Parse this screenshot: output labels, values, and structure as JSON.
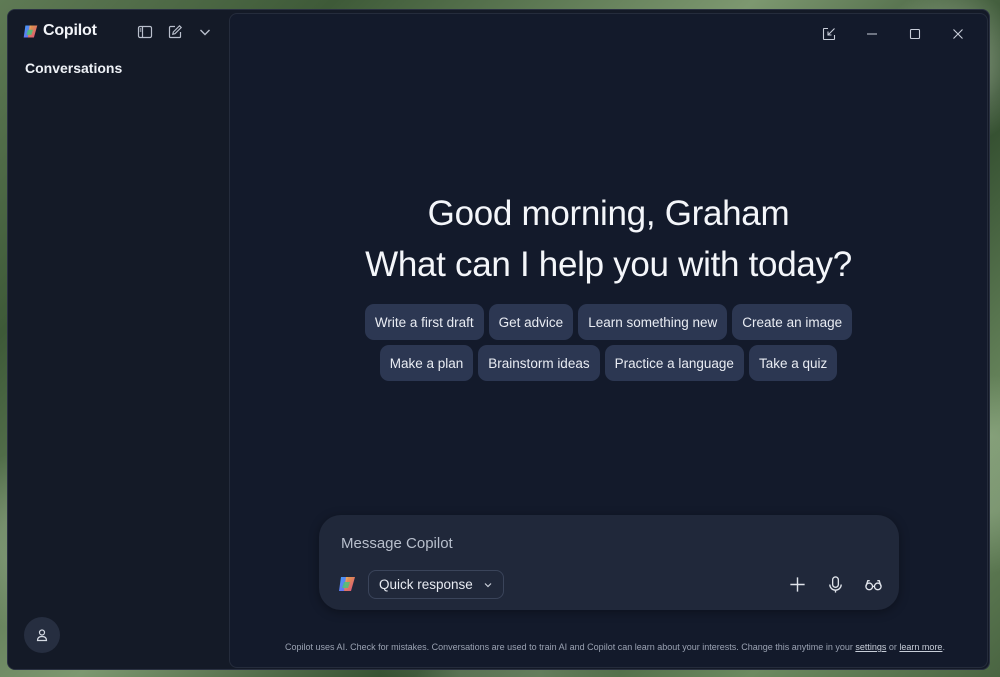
{
  "app": {
    "name": "Copilot"
  },
  "sidebar": {
    "heading": "Conversations"
  },
  "main": {
    "greeting_line1": "Good morning, Graham",
    "greeting_line2": "What can I help you with today?",
    "suggestions_row1": [
      "Write a first draft",
      "Get advice",
      "Learn something new",
      "Create an image"
    ],
    "suggestions_row2": [
      "Make a plan",
      "Brainstorm ideas",
      "Practice a language",
      "Take a quiz"
    ]
  },
  "composer": {
    "placeholder": "Message Copilot",
    "mode_label": "Quick response"
  },
  "footer": {
    "text": "Copilot uses AI. Check for mistakes. Conversations are used to train AI and Copilot can learn about your interests. Change this anytime in your",
    "settings_link": "settings",
    "or_text": "or",
    "learn_more_link": "learn more",
    "period": "."
  },
  "colors": {
    "window_bg": "#141a27",
    "chip_bg": "#2c3752",
    "composer_bg": "#20283a"
  }
}
